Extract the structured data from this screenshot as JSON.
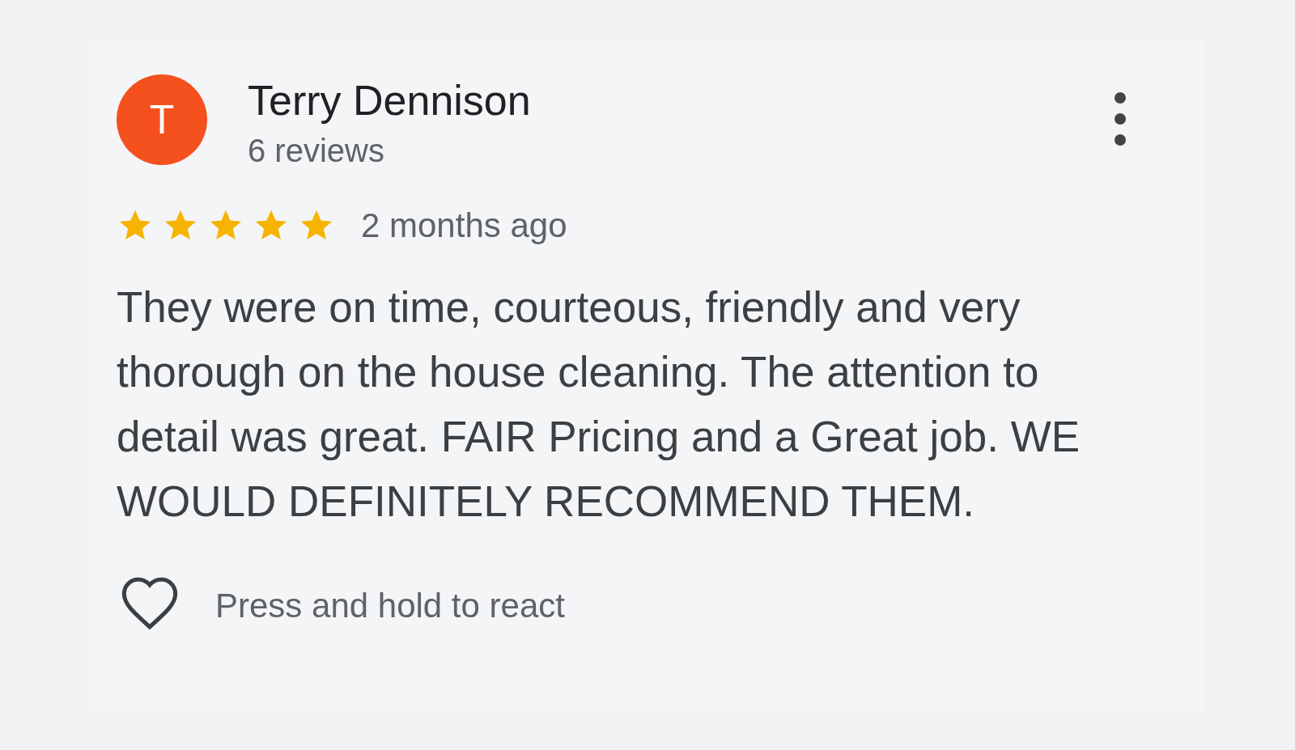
{
  "review": {
    "avatar_letter": "T",
    "author": "Terry Dennison",
    "review_count": "6 reviews",
    "stars": 5,
    "time": "2 months ago",
    "text": "They were on time, courteous, friendly and very thorough on the house cleaning. The attention to detail was great. FAIR Pricing and a Great job. WE WOULD DEFINITELY RECOMMEND THEM.",
    "react_hint": "Press and hold to react"
  }
}
